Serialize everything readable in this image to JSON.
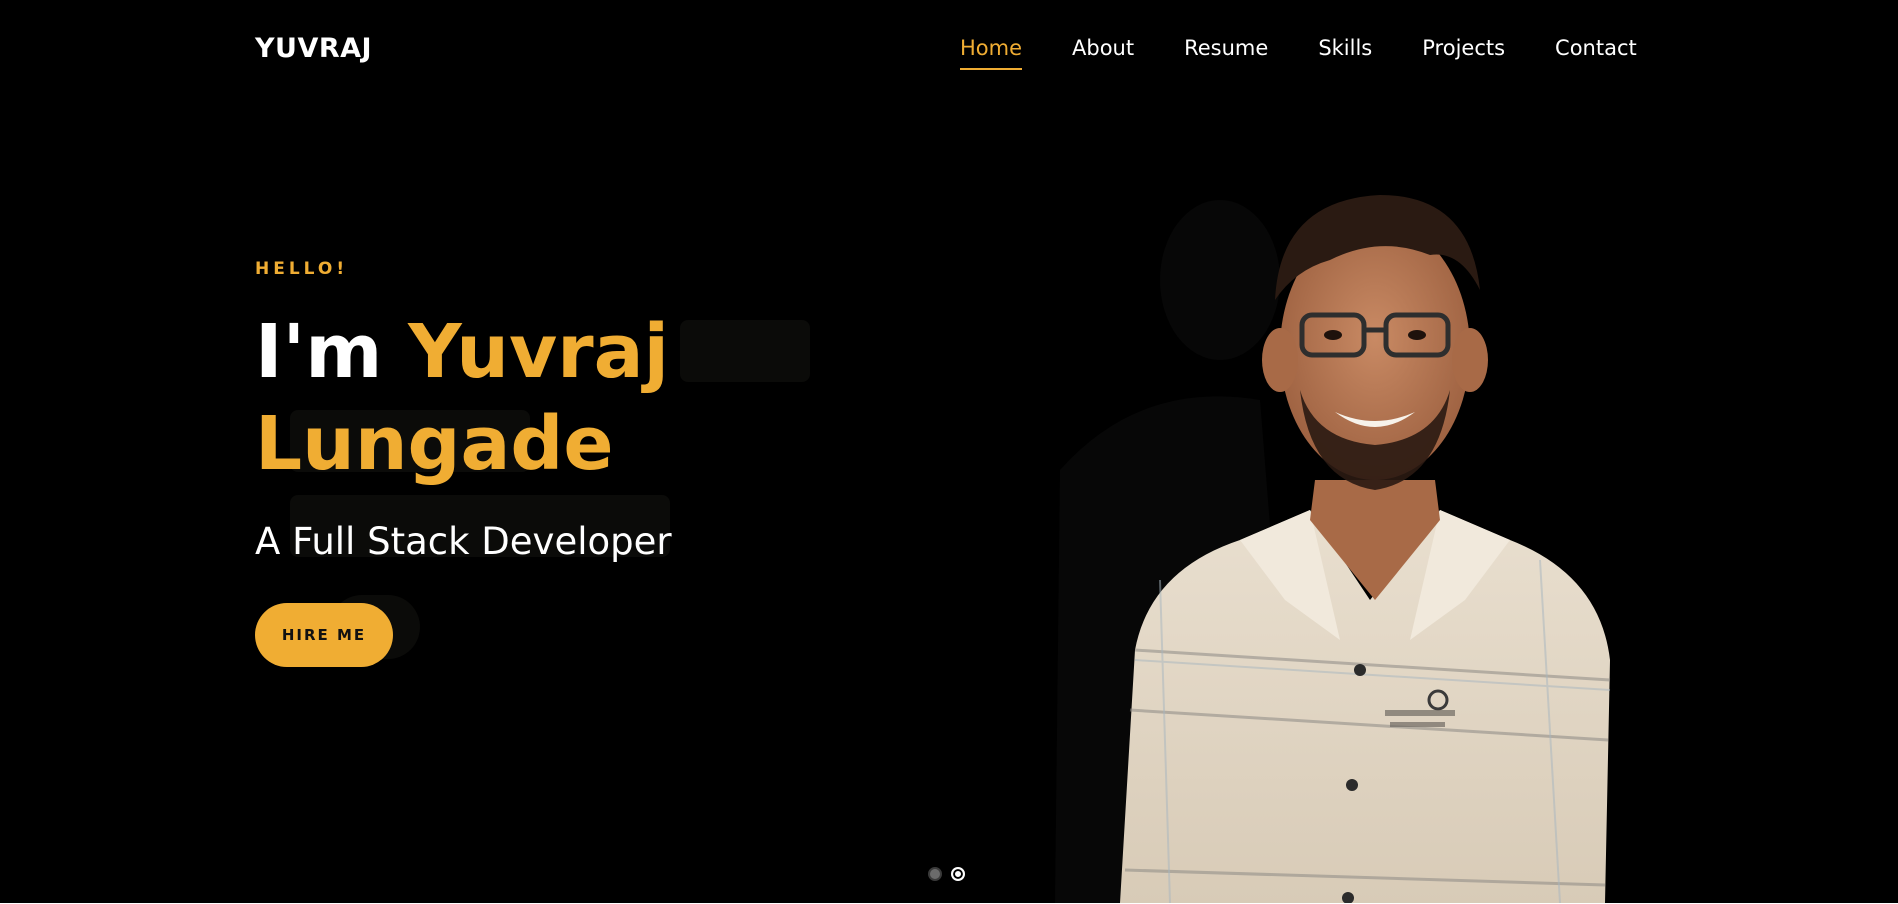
{
  "brand": "YUVRAJ",
  "nav": {
    "items": [
      {
        "label": "Home",
        "active": true
      },
      {
        "label": "About",
        "active": false
      },
      {
        "label": "Resume",
        "active": false
      },
      {
        "label": "Skills",
        "active": false
      },
      {
        "label": "Projects",
        "active": false
      },
      {
        "label": "Contact",
        "active": false
      }
    ]
  },
  "hero": {
    "greeting": "HELLO!",
    "intro": "I'm ",
    "name": "Yuvraj Lungade",
    "subtitle": "A Full Stack Developer",
    "cta_label": "HIRE ME"
  },
  "slider": {
    "count": 2,
    "active_index": 1
  },
  "colors": {
    "background": "#000000",
    "accent": "#f0ad33",
    "text": "#ffffff"
  },
  "icons": {
    "portrait": "person-photo"
  }
}
